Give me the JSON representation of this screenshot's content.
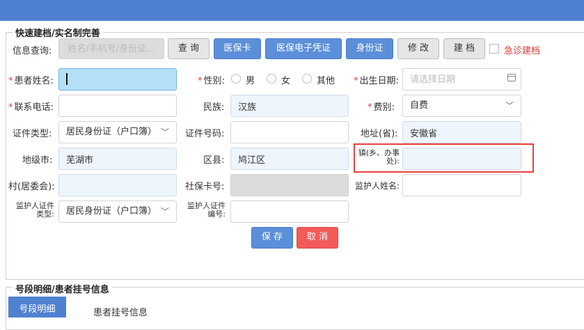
{
  "section_title": "快速建档/实名制完善",
  "search": {
    "label": "信息查询:",
    "placeholder": "姓名/手机号/身份证...",
    "query_button": "查 询",
    "medical_card_button": "医保卡",
    "medical_voucher_button": "医保电子凭证",
    "id_card_button": "身份证",
    "modify_button": "修 改",
    "create_button": "建 档",
    "emergency_label": "急诊建档"
  },
  "form": {
    "patient_name_label": "患者姓名:",
    "patient_name_value": "",
    "gender_label": "性别:",
    "gender_options": [
      "男",
      "女",
      "其他"
    ],
    "birth_date_label": "出生日期:",
    "birth_date_placeholder": "请选择日期",
    "phone_label": "联系电话:",
    "phone_value": "",
    "ethnicity_label": "民族:",
    "ethnicity_value": "汉族",
    "fee_type_label": "费别:",
    "fee_type_value": "自费",
    "id_type_label": "证件类型:",
    "id_type_value": "居民身份证（户口簿）",
    "id_number_label": "证件号码:",
    "id_number_value": "",
    "province_label": "地址(省):",
    "province_value": "安徽省",
    "city_label": "地级市:",
    "city_value": "芜湖市",
    "district_label": "区县:",
    "district_value": "鸠江区",
    "street_label": "镇(乡、办事处):",
    "street_value": "",
    "village_label": "村(居委会):",
    "village_value": "",
    "social_card_label": "社保卡号:",
    "social_card_value": "",
    "guardian_name_label": "监护人姓名:",
    "guardian_name_value": "",
    "guardian_id_type_label": "监护人证件类型:",
    "guardian_id_type_value": "居民身份证（户口簿）",
    "guardian_id_number_label": "监护人证件编号:",
    "guardian_id_number_value": ""
  },
  "actions": {
    "save": "保 存",
    "cancel": "取 消"
  },
  "section2_title": "号段明细/患者挂号信息",
  "tabs": {
    "tab1": "号段明细",
    "tab2": "患者挂号信息"
  },
  "icons": {
    "calendar": "calendar-icon",
    "chevron": "chevron-down-icon"
  },
  "colors": {
    "header": "#4f81d0",
    "required": "#e23b3b",
    "primary_button": "#5b8fd9",
    "cancel_button": "#f35a5a",
    "highlight_box": "#e84040"
  }
}
